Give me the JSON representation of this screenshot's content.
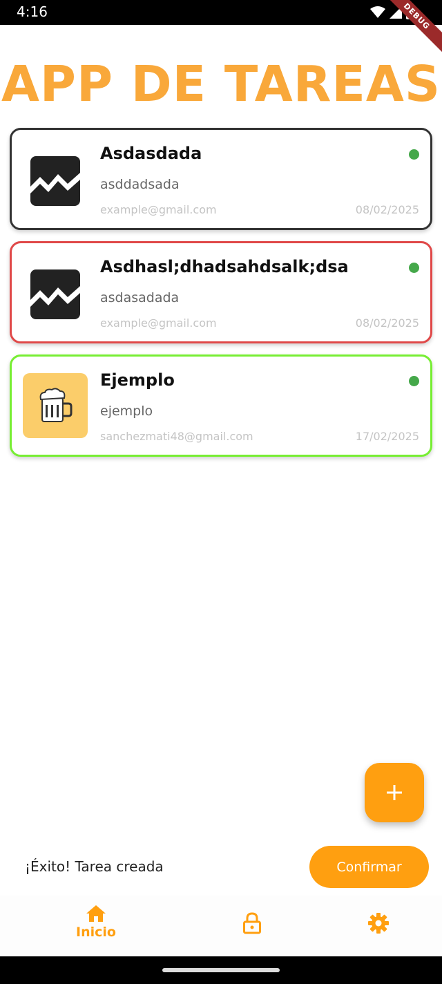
{
  "status_bar": {
    "time": "4:16",
    "debug_label": "DEBUG"
  },
  "app": {
    "title": "APP DE TAREAS"
  },
  "tasks": [
    {
      "title": "Asdasdada",
      "description": "asddadsada",
      "email": "example@gmail.com",
      "date": "08/02/2025",
      "border": "dark",
      "image": "broken-image-icon"
    },
    {
      "title": "Asdhasl;dhadsahdsalk;dsa",
      "description": "asdasadada",
      "email": "example@gmail.com",
      "date": "08/02/2025",
      "border": "red",
      "image": "broken-image-icon"
    },
    {
      "title": "Ejemplo",
      "description": "ejemplo",
      "email": "sanchezmati48@gmail.com",
      "date": "17/02/2025",
      "border": "green",
      "image": "beer-mug-icon"
    }
  ],
  "fab": {
    "icon": "plus-icon"
  },
  "snackbar": {
    "message": "¡Éxito! Tarea creada",
    "action": "Confirmar"
  },
  "bottom_nav": {
    "items": [
      {
        "label": "Inicio",
        "icon": "home-icon",
        "active": true
      },
      {
        "label": "",
        "icon": "lock-icon"
      },
      {
        "label": "",
        "icon": "gear-icon"
      }
    ]
  },
  "colors": {
    "accent": "#ff9f10",
    "title": "#f9a83a",
    "status_dot": "#45a84a",
    "border_red": "#e04848",
    "border_green": "#77ee33"
  }
}
